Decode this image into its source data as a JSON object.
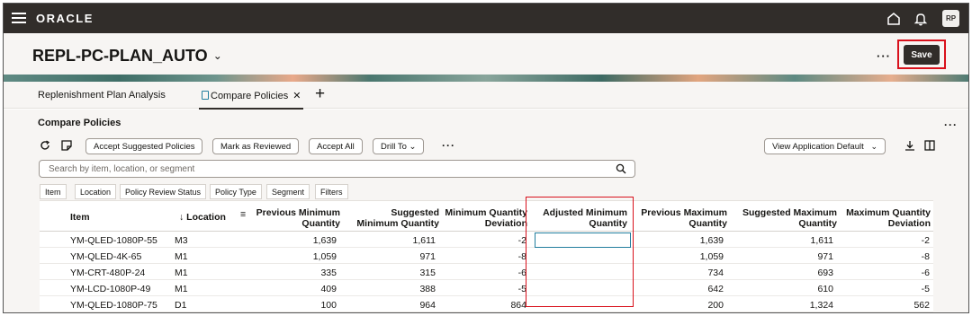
{
  "app": {
    "brand": "ORACLE",
    "avatar_initials": "RP"
  },
  "header": {
    "title": "REPL-PC-PLAN_AUTO",
    "save_label": "Save"
  },
  "tabs": [
    {
      "label": "Replenishment Plan Analysis",
      "active": false
    },
    {
      "label": "Compare Policies",
      "active": true
    }
  ],
  "section": {
    "title": "Compare Policies"
  },
  "toolbar": {
    "accept_suggested": "Accept Suggested Policies",
    "mark_reviewed": "Mark as Reviewed",
    "accept_all": "Accept All",
    "drill_to": "Drill To",
    "view": "View Application Default"
  },
  "search": {
    "placeholder": "Search by item, location, or segment"
  },
  "filters": [
    "Item",
    "Location",
    "Policy Review Status",
    "Policy Type",
    "Segment",
    "Filters"
  ],
  "table": {
    "columns": {
      "item": "Item",
      "location": "Location",
      "prev_min_1": "Previous Minimum",
      "prev_min_2": "Quantity",
      "sugg_min_1": "Suggested",
      "sugg_min_2": "Minimum Quantity",
      "min_dev_1": "Minimum Quantity",
      "min_dev_2": "Deviation",
      "adj_min_1": "Adjusted Minimum",
      "adj_min_2": "Quantity",
      "prev_max_1": "Previous Maximum",
      "prev_max_2": "Quantity",
      "sugg_max_1": "Suggested Maximum",
      "sugg_max_2": "Quantity",
      "max_dev_1": "Maximum Quantity",
      "max_dev_2": "Deviation"
    },
    "rows": [
      {
        "item": "YM-QLED-1080P-55",
        "location": "M3",
        "prev_min": "1,639",
        "sugg_min": "1,611",
        "min_dev": "-2",
        "prev_max": "1,639",
        "sugg_max": "1,611",
        "max_dev": "-2"
      },
      {
        "item": "YM-QLED-4K-65",
        "location": "M1",
        "prev_min": "1,059",
        "sugg_min": "971",
        "min_dev": "-8",
        "prev_max": "1,059",
        "sugg_max": "971",
        "max_dev": "-8"
      },
      {
        "item": "YM-CRT-480P-24",
        "location": "M1",
        "prev_min": "335",
        "sugg_min": "315",
        "min_dev": "-6",
        "prev_max": "734",
        "sugg_max": "693",
        "max_dev": "-6"
      },
      {
        "item": "YM-LCD-1080P-49",
        "location": "M1",
        "prev_min": "409",
        "sugg_min": "388",
        "min_dev": "-5",
        "prev_max": "642",
        "sugg_max": "610",
        "max_dev": "-5"
      },
      {
        "item": "YM-QLED-1080P-75",
        "location": "D1",
        "prev_min": "100",
        "sugg_min": "964",
        "min_dev": "864",
        "prev_max": "200",
        "sugg_max": "1,324",
        "max_dev": "562"
      }
    ]
  }
}
